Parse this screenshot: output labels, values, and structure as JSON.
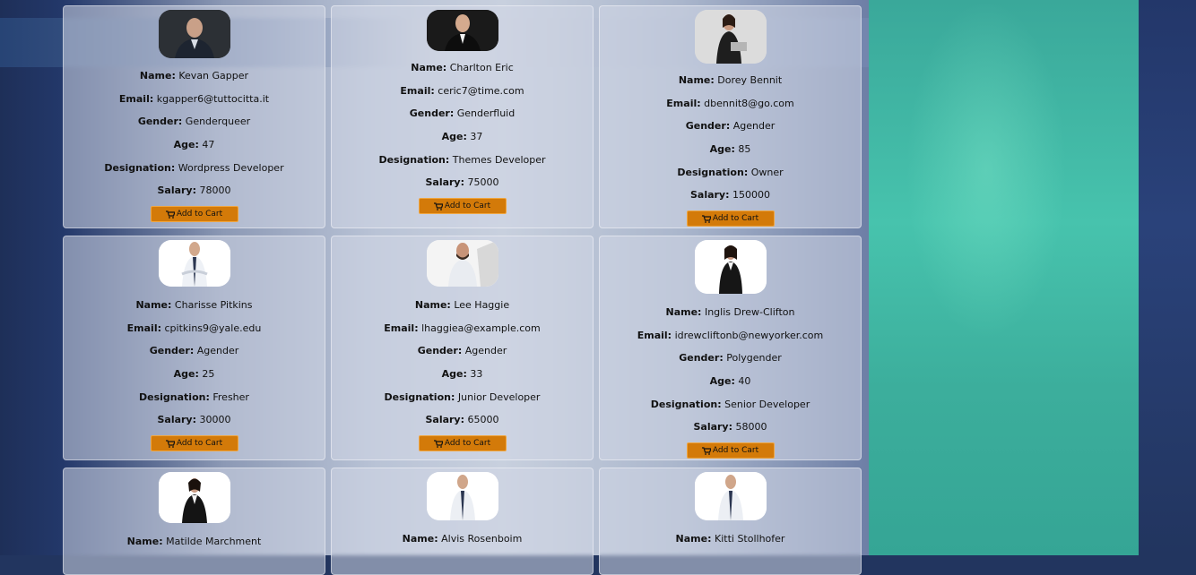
{
  "labels": {
    "name": "Name:",
    "email": "Email:",
    "gender": "Gender:",
    "age": "Age:",
    "designation": "Designation:",
    "salary": "Salary:",
    "add_to_cart": "Add to Cart"
  },
  "employees": [
    {
      "name": "Kevan Gapper",
      "email": "kgapper6@tuttocitta.it",
      "gender": "Genderqueer",
      "age": "47",
      "designation": "Wordpress Developer",
      "salary": "78000"
    },
    {
      "name": "Charlton Eric",
      "email": "ceric7@time.com",
      "gender": "Genderfluid",
      "age": "37",
      "designation": "Themes Developer",
      "salary": "75000"
    },
    {
      "name": "Dorey Bennit",
      "email": "dbennit8@go.com",
      "gender": "Agender",
      "age": "85",
      "designation": "Owner",
      "salary": "150000"
    },
    {
      "name": "Charisse Pitkins",
      "email": "cpitkins9@yale.edu",
      "gender": "Agender",
      "age": "25",
      "designation": "Fresher",
      "salary": "30000"
    },
    {
      "name": "Lee Haggie",
      "email": "lhaggiea@example.com",
      "gender": "Agender",
      "age": "33",
      "designation": "Junior Developer",
      "salary": "65000"
    },
    {
      "name": "Inglis Drew-Clifton",
      "email": "idrewcliftonb@newyorker.com",
      "gender": "Polygender",
      "age": "40",
      "designation": "Senior Developer",
      "salary": "58000"
    },
    {
      "name": "Matilde Marchment"
    },
    {
      "name": "Alvis Rosenboim"
    },
    {
      "name": "Kitti Stollhofer"
    }
  ],
  "colors": {
    "button": "#d37a09",
    "teal_panel": "#47c3ad",
    "card": "rgba(210,215,230,0.55)"
  }
}
